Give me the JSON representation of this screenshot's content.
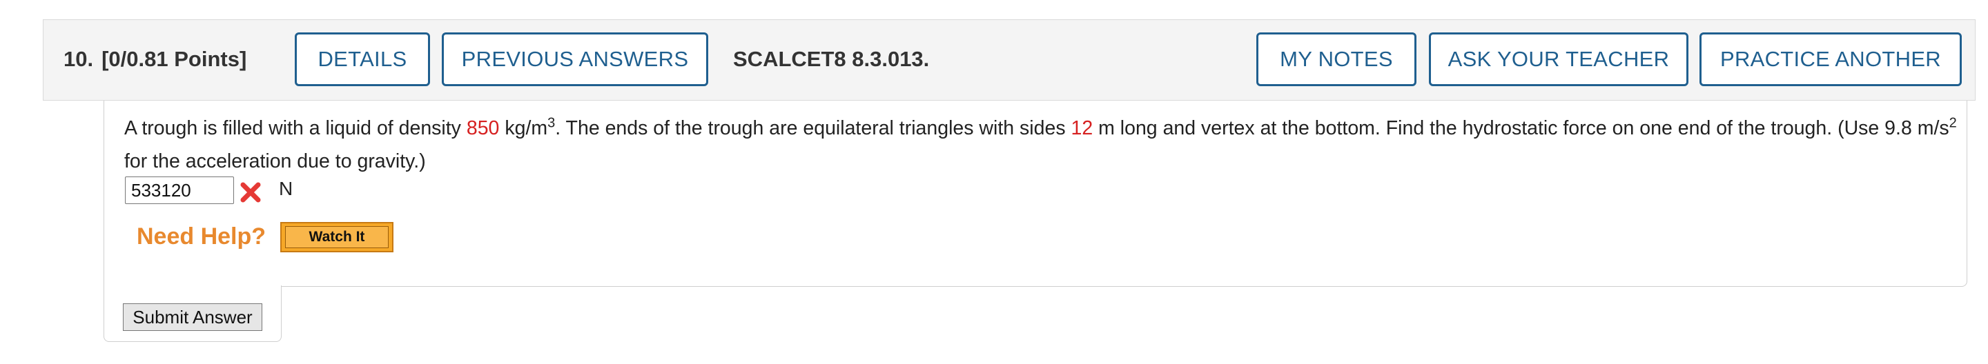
{
  "question": {
    "number": "10.",
    "points": "[0/0.81 Points]",
    "id": "SCALCET8 8.3.013.",
    "buttons": {
      "details": "DETAILS",
      "previous_answers": "PREVIOUS ANSWERS",
      "my_notes": "MY NOTES",
      "ask_teacher": "ASK YOUR TEACHER",
      "practice_another": "PRACTICE ANOTHER"
    },
    "text": {
      "part1": "A trough is filled with a liquid of density ",
      "density": "850",
      "part2": " kg/m",
      "sup1": "3",
      "part3": ". The ends of the trough are equilateral triangles with sides ",
      "side": "12",
      "part4": " m long and vertex at the bottom. Find the hydrostatic force on one end of the trough. (Use 9.8 m/s",
      "sup2": "2",
      "part5": " for the acceleration due to gravity.)"
    },
    "answer": {
      "value": "533120",
      "unit": "N",
      "status_icon": "x-mark-icon"
    },
    "help": {
      "label": "Need Help?",
      "watch_button": "Watch It"
    },
    "submit_label": "Submit Answer",
    "colors": {
      "button_blue": "#1f5f8f",
      "highlight_red": "#d62020",
      "help_orange": "#e8892e",
      "wrong_red": "#e53935"
    }
  }
}
